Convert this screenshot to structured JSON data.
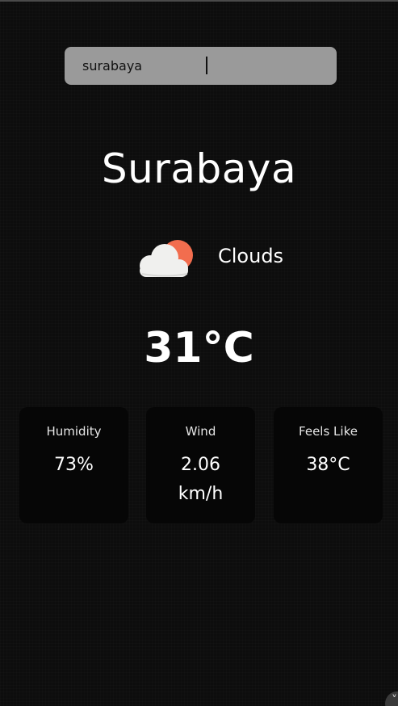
{
  "search": {
    "value": "surabaya",
    "placeholder": ""
  },
  "location": {
    "city": "Surabaya"
  },
  "condition": {
    "icon": "cloud-sun-icon",
    "label": "Clouds"
  },
  "temperature": "31°C",
  "stats": [
    {
      "label": "Humidity",
      "value": "73%"
    },
    {
      "label": "Wind",
      "value": "2.06 km/h"
    },
    {
      "label": "Feels Like",
      "value": "38°C"
    }
  ],
  "colors": {
    "background": "#0d0d0d",
    "search_bg": "#9a9a9a",
    "card_bg": "#060606",
    "sun": "#f26d4e",
    "cloud": "#f0f0ee"
  }
}
